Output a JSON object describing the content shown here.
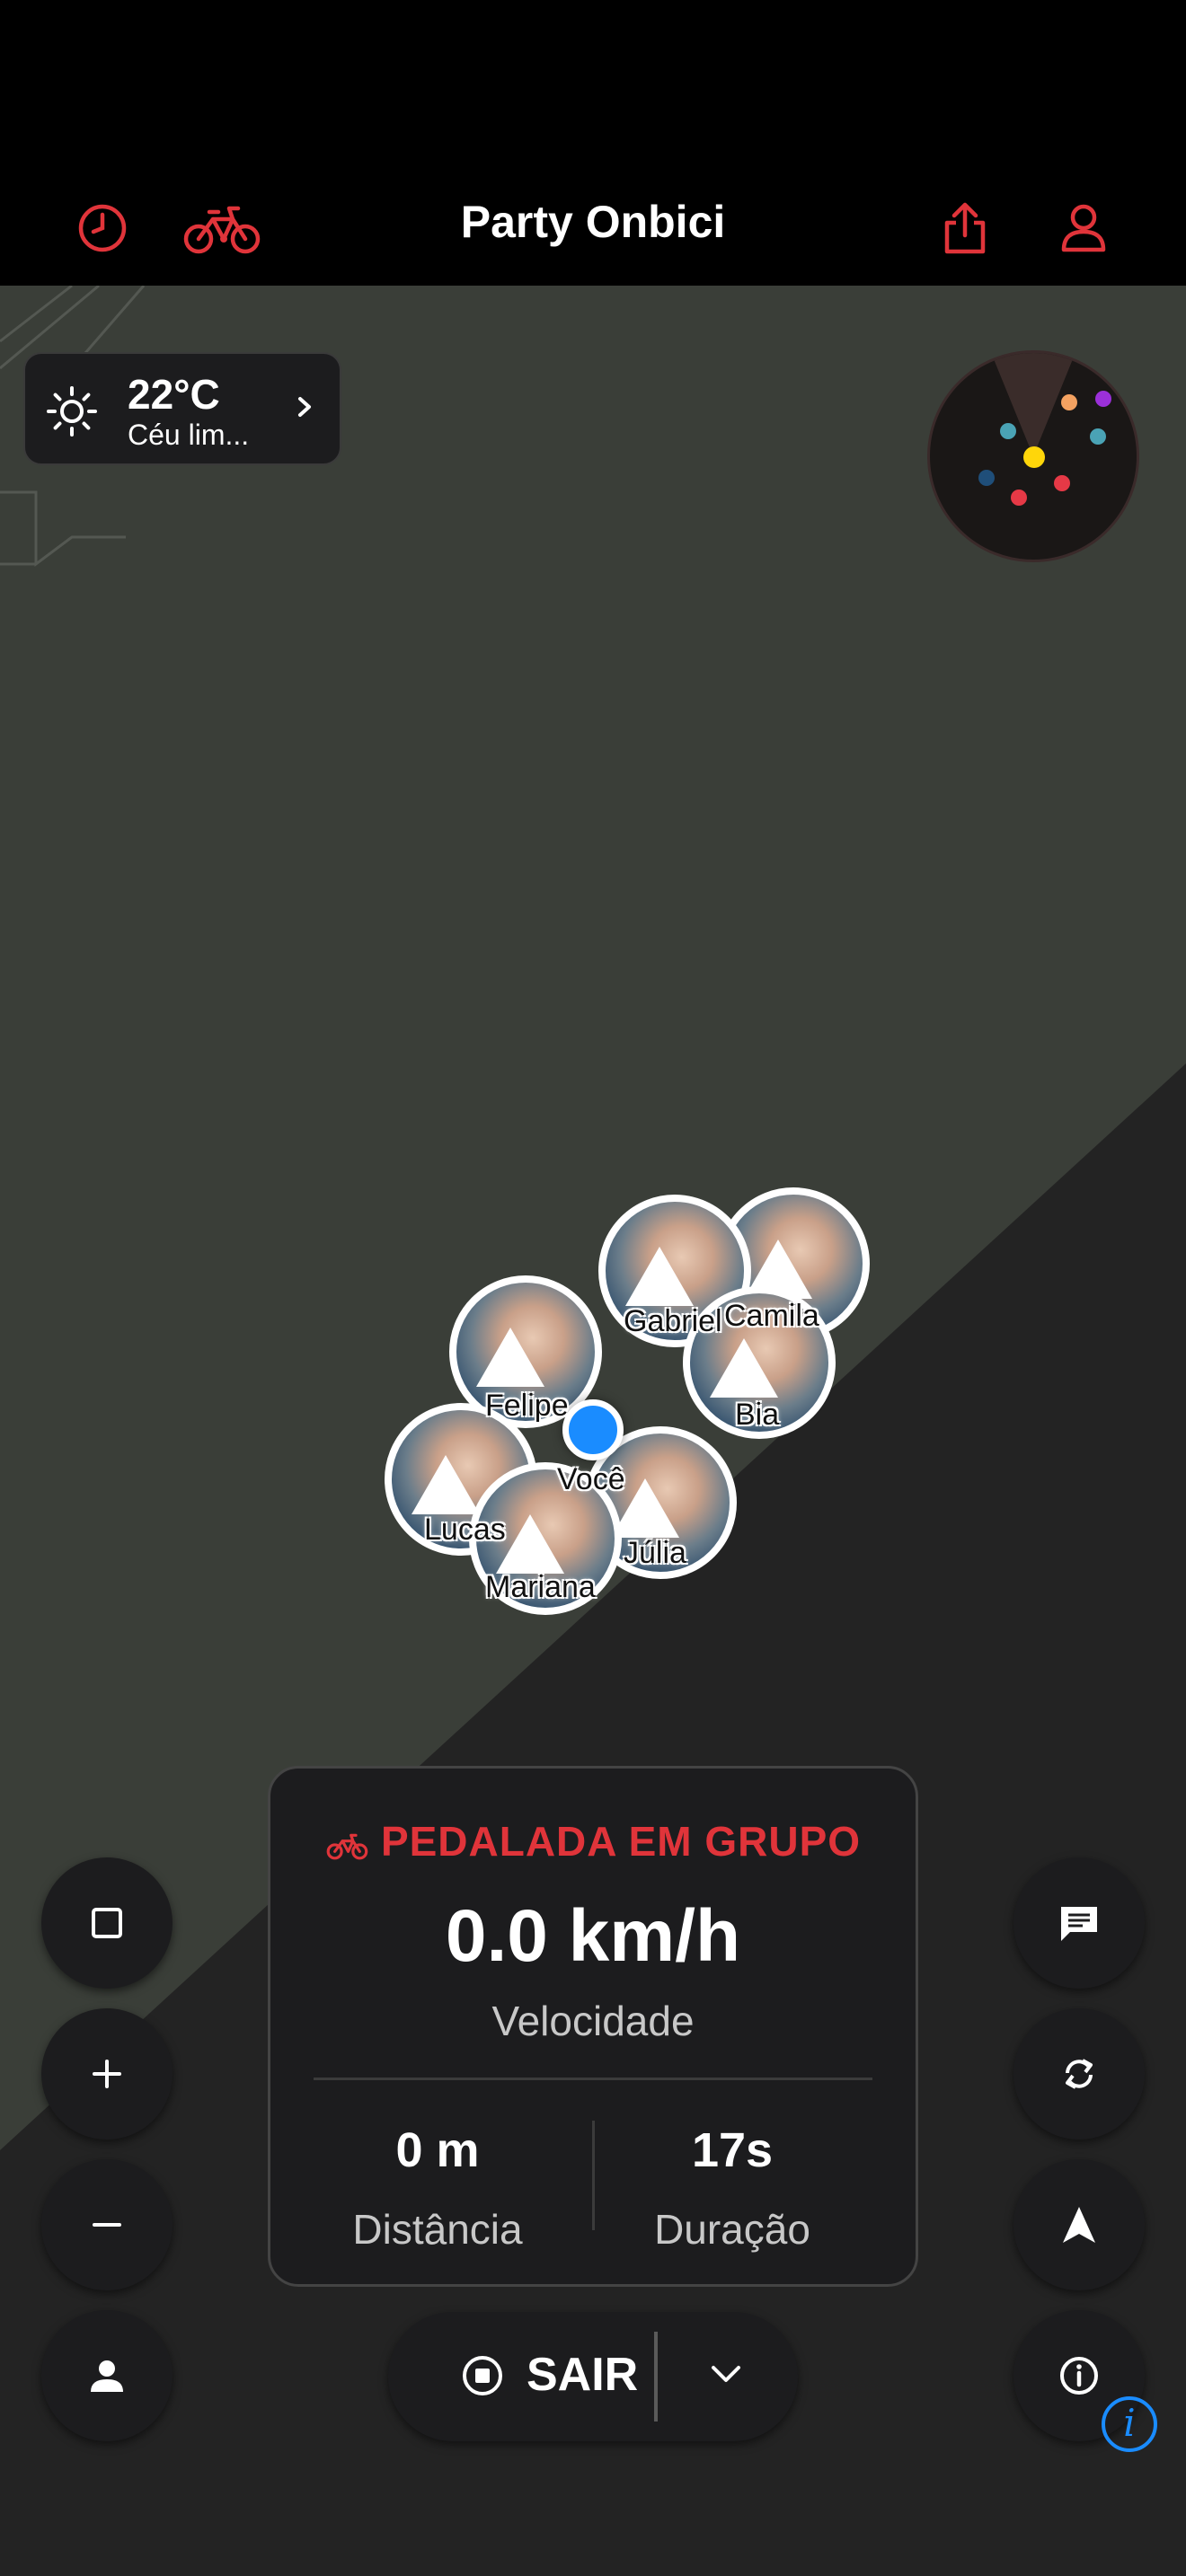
{
  "header": {
    "title": "Party Onbici",
    "icons": [
      "history-icon",
      "bike-icon",
      "share-icon",
      "profile-icon"
    ],
    "accent_color": "#e0343a"
  },
  "weather": {
    "temperature": "22°C",
    "condition": "Céu lim..."
  },
  "map": {
    "markers": [
      {
        "name": "Gabriel"
      },
      {
        "name": "Camila"
      },
      {
        "name": "Felipe"
      },
      {
        "name": "Bia"
      },
      {
        "name": "Você"
      },
      {
        "name": "Lucas"
      },
      {
        "name": "Júlia"
      },
      {
        "name": "Mariana"
      }
    ],
    "radar_dot_colors": [
      "#f4a261",
      "#9b30d9",
      "#4aa3b5",
      "#ffd60a",
      "#e63946",
      "#1f4e79"
    ]
  },
  "ride_panel": {
    "tag": "PEDALADA EM GRUPO",
    "speed": "0.0 km/h",
    "speed_label": "Velocidade",
    "distance": "0 m",
    "distance_label": "Distância",
    "duration": "17s",
    "duration_label": "Duração"
  },
  "controls": {
    "exit_label": "SAIR",
    "left_icons": [
      "stop-square-icon",
      "zoom-in-icon",
      "zoom-out-icon",
      "person-icon"
    ],
    "right_icons": [
      "chat-icon",
      "refresh-icon",
      "navigate-icon",
      "info-icon"
    ]
  },
  "info_badge": "i"
}
